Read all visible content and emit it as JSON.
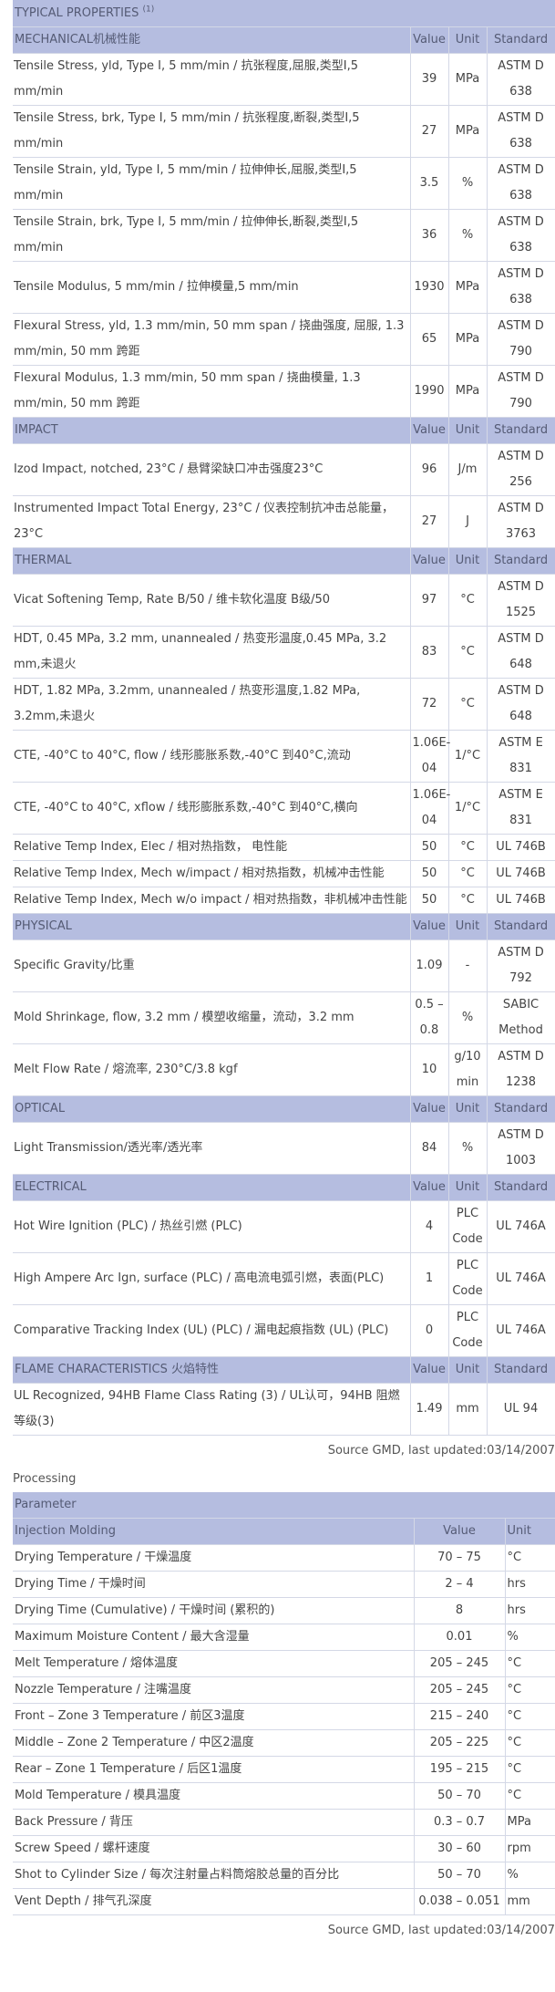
{
  "properties": {
    "title": "TYPICAL PROPERTIES",
    "title_note": "(1)",
    "header_value": "Value",
    "header_unit": "Unit",
    "header_standard": "Standard",
    "sections": [
      {
        "name": "MECHANICAL机械性能",
        "rows": [
          {
            "name": "Tensile Stress, yld, Type I, 5 mm/min / 抗张程度,屈服,类型I,5 mm/min",
            "value": "39",
            "unit": "MPa",
            "standard": "ASTM D 638"
          },
          {
            "name": "Tensile Stress, brk, Type I, 5 mm/min / 抗张程度,断裂,类型I,5 mm/min",
            "value": "27",
            "unit": "MPa",
            "standard": "ASTM D 638"
          },
          {
            "name": "Tensile Strain, yld, Type I, 5 mm/min / 拉伸伸长,屈服,类型I,5 mm/min",
            "value": "3.5",
            "unit": "%",
            "standard": "ASTM D 638"
          },
          {
            "name": "Tensile Strain, brk, Type I, 5 mm/min / 拉伸伸长,断裂,类型I,5 mm/min",
            "value": "36",
            "unit": "%",
            "standard": "ASTM D 638"
          },
          {
            "name": "Tensile Modulus, 5 mm/min / 拉伸模量,5 mm/min",
            "value": "1930",
            "unit": "MPa",
            "standard": "ASTM D 638"
          },
          {
            "name": "Flexural Stress, yld, 1.3 mm/min, 50 mm span / 挠曲强度, 屈服, 1.3 mm/min, 50 mm 跨距",
            "value": "65",
            "unit": "MPa",
            "standard": "ASTM D 790"
          },
          {
            "name": "Flexural Modulus, 1.3 mm/min, 50 mm span / 挠曲模量, 1.3 mm/min, 50 mm 跨距",
            "value": "1990",
            "unit": "MPa",
            "standard": "ASTM D 790"
          }
        ]
      },
      {
        "name": "IMPACT",
        "rows": [
          {
            "name": "Izod Impact, notched, 23°C / 悬臂梁缺口冲击强度23°C",
            "value": "96",
            "unit": "J/m",
            "standard": "ASTM D 256"
          },
          {
            "name": "Instrumented Impact Total Energy, 23°C / 仪表控制抗冲击总能量，23°C",
            "value": "27",
            "unit": "J",
            "standard": "ASTM D 3763"
          }
        ]
      },
      {
        "name": "THERMAL",
        "rows": [
          {
            "name": "Vicat Softening Temp, Rate B/50 / 维卡软化温度 B级/50",
            "value": "97",
            "unit": "°C",
            "standard": "ASTM D 1525"
          },
          {
            "name": "HDT, 0.45 MPa, 3.2 mm, unannealed / 热变形温度,0.45 MPa, 3.2 mm,未退火",
            "value": "83",
            "unit": "°C",
            "standard": "ASTM D 648"
          },
          {
            "name": "HDT, 1.82 MPa, 3.2mm, unannealed / 热变形温度,1.82 MPa, 3.2mm,未退火",
            "value": "72",
            "unit": "°C",
            "standard": "ASTM D 648"
          },
          {
            "name": "CTE, -40°C to 40°C, flow / 线形膨胀系数,-40°C 到40°C,流动",
            "value": "1.06E-04",
            "unit": "1/°C",
            "standard": "ASTM E 831"
          },
          {
            "name": "CTE, -40°C to 40°C, xflow / 线形膨胀系数,-40°C 到40°C,横向",
            "value": "1.06E-04",
            "unit": "1/°C",
            "standard": "ASTM E 831"
          },
          {
            "name": "Relative Temp Index, Elec / 相对热指数， 电性能",
            "value": "50",
            "unit": "°C",
            "standard": "UL 746B"
          },
          {
            "name": "Relative Temp Index, Mech w/impact / 相对热指数，机械冲击性能",
            "value": "50",
            "unit": "°C",
            "standard": "UL 746B"
          },
          {
            "name": "Relative Temp Index, Mech w/o impact / 相对热指数，非机械冲击性能",
            "value": "50",
            "unit": "°C",
            "standard": "UL 746B"
          }
        ]
      },
      {
        "name": "PHYSICAL",
        "rows": [
          {
            "name": "Specific Gravity/比重",
            "value": "1.09",
            "unit": "-",
            "standard": "ASTM D 792"
          },
          {
            "name": "Mold Shrinkage, flow, 3.2 mm / 模塑收缩量，流动，3.2 mm",
            "value": "0.5 – 0.8",
            "unit": "%",
            "standard": "SABIC Method"
          },
          {
            "name": "Melt Flow Rate / 熔流率, 230°C/3.8 kgf",
            "value": "10",
            "unit": "g/10 min",
            "standard": "ASTM D 1238"
          }
        ]
      },
      {
        "name": "OPTICAL",
        "rows": [
          {
            "name": "Light Transmission/透光率/透光率",
            "value": "84",
            "unit": "%",
            "standard": "ASTM D 1003"
          }
        ]
      },
      {
        "name": "ELECTRICAL",
        "rows": [
          {
            "name": "Hot Wire Ignition (PLC) / 热丝引燃 (PLC)",
            "value": "4",
            "unit": "PLC Code",
            "standard": "UL 746A"
          },
          {
            "name": "High Ampere Arc Ign, surface (PLC) / 高电流电弧引燃，表面(PLC)",
            "value": "1",
            "unit": "PLC Code",
            "standard": "UL 746A"
          },
          {
            "name": "Comparative Tracking Index (UL) (PLC) / 漏电起痕指数 (UL) (PLC)",
            "value": "0",
            "unit": "PLC Code",
            "standard": "UL 746A"
          }
        ]
      },
      {
        "name": "FLAME CHARACTERISTICS 火焰特性",
        "rows": [
          {
            "name": "UL Recognized, 94HB Flame Class Rating (3) / UL认可，94HB 阻燃等级(3)",
            "value": "1.49",
            "unit": "mm",
            "standard": "UL 94"
          }
        ]
      }
    ],
    "source": "Source GMD, last updated:03/14/2007"
  },
  "processing": {
    "title": "Processing",
    "header_parameter": "Parameter",
    "section": "Injection Molding",
    "header_value": "Value",
    "header_unit": "Unit",
    "rows": [
      {
        "name": "Drying Temperature / 干燥温度",
        "value": "70 – 75",
        "unit": "°C"
      },
      {
        "name": "Drying Time / 干燥时间",
        "value": "2 – 4",
        "unit": "hrs"
      },
      {
        "name": "Drying Time (Cumulative) / 干燥时间 (累积的)",
        "value": "8",
        "unit": "hrs"
      },
      {
        "name": "Maximum Moisture Content / 最大含湿量",
        "value": "0.01",
        "unit": "%"
      },
      {
        "name": "Melt Temperature / 熔体温度",
        "value": "205 – 245",
        "unit": "°C"
      },
      {
        "name": "Nozzle Temperature / 注嘴温度",
        "value": "205 – 245",
        "unit": "°C"
      },
      {
        "name": "Front – Zone 3 Temperature / 前区3温度",
        "value": "215 – 240",
        "unit": "°C"
      },
      {
        "name": "Middle – Zone 2 Temperature / 中区2温度",
        "value": "205 – 225",
        "unit": "°C"
      },
      {
        "name": "Rear – Zone 1 Temperature / 后区1温度",
        "value": "195 – 215",
        "unit": "°C"
      },
      {
        "name": "Mold Temperature / 模具温度",
        "value": "50 – 70",
        "unit": "°C"
      },
      {
        "name": "Back Pressure / 背压",
        "value": "0.3 – 0.7",
        "unit": "MPa"
      },
      {
        "name": "Screw Speed / 螺杆速度",
        "value": "30 – 60",
        "unit": "rpm"
      },
      {
        "name": "Shot to Cylinder Size / 每次注射量占料筒熔胶总量的百分比",
        "value": "50 – 70",
        "unit": "%"
      },
      {
        "name": "Vent Depth / 排气孔深度",
        "value": "0.038 – 0.051",
        "unit": "mm"
      }
    ],
    "source": "Source GMD, last updated:03/14/2007"
  }
}
